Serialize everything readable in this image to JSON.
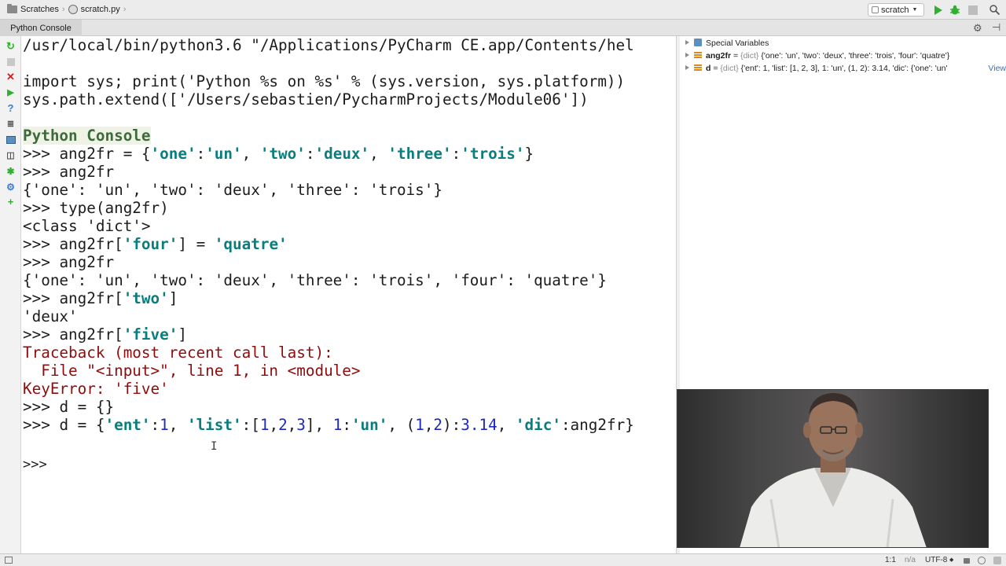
{
  "navbar": {
    "breadcrumb": [
      "Scratches",
      "scratch.py"
    ],
    "run_config": "scratch"
  },
  "tool_window": {
    "title": "Python Console"
  },
  "console": {
    "startup_command": "/usr/local/bin/python3.6 \"/Applications/PyCharm CE.app/Contents/hel",
    "import_line": "import sys; print('Python %s on %s' % (sys.version, sys.platform))",
    "path_line": "sys.path.extend(['/Users/sebastien/PycharmProjects/Module06'])",
    "header": "Python Console",
    "prompt": ">>>",
    "cmd1": "ang2fr = {'one':'un', 'two':'deux', 'three':'trois'}",
    "cmd1_prefix": "ang2fr = {",
    "cmd1_s1": "'one'",
    "cmd1_s2": "'un'",
    "cmd1_s3": "'two'",
    "cmd1_s4": "'deux'",
    "cmd1_s5": "'three'",
    "cmd1_s6": "'trois'",
    "cmd2": "ang2fr",
    "out2": "{'one': 'un', 'two': 'deux', 'three': 'trois'}",
    "cmd3": "type(ang2fr)",
    "out3": "<class 'dict'>",
    "cmd4_a": "ang2fr[",
    "cmd4_key": "'four'",
    "cmd4_b": "] = ",
    "cmd4_val": "'quatre'",
    "cmd5": "ang2fr",
    "out5": "{'one': 'un', 'two': 'deux', 'three': 'trois', 'four': 'quatre'}",
    "cmd6_a": "ang2fr[",
    "cmd6_key": "'two'",
    "cmd6_b": "]",
    "out6": "'deux'",
    "cmd7_a": "ang2fr[",
    "cmd7_key": "'five'",
    "cmd7_b": "]",
    "tb1": "Traceback (most recent call last):",
    "tb2": "  File \"<input>\", line 1, in <module>",
    "tb3": "KeyError: 'five'",
    "cmd8": "d = {}",
    "cmd9_a": "d = {",
    "cmd9_s1": "'ent'",
    "cmd9_c1": ":",
    "cmd9_n1": "1",
    "cmd9_c2": ", ",
    "cmd9_s2": "'list'",
    "cmd9_c3": ":[",
    "cmd9_n2": "1",
    "cmd9_c4": ",",
    "cmd9_n3": "2",
    "cmd9_c5": ",",
    "cmd9_n4": "3",
    "cmd9_c6": "], ",
    "cmd9_n5": "1",
    "cmd9_c7": ":",
    "cmd9_s3": "'un'",
    "cmd9_c8": ", (",
    "cmd9_n6": "1",
    "cmd9_c9": ",",
    "cmd9_n7": "2",
    "cmd9_c10": "):",
    "cmd9_n8": "3.14",
    "cmd9_c11": ", ",
    "cmd9_s4": "'dic'",
    "cmd9_c12": ":ang2fr}"
  },
  "variables": {
    "header": "Special Variables",
    "rows": [
      {
        "name": "ang2fr",
        "type": "{dict}",
        "value": "{'one': 'un', 'two': 'deux', 'three': 'trois', 'four': 'quatre'}"
      },
      {
        "name": "d",
        "type": "{dict}",
        "value": "{'ent': 1, 'list': [1, 2, 3], 1: 'un', (1, 2): 3.14, 'dic': {'one': 'un'",
        "link": "View"
      }
    ]
  },
  "statusbar": {
    "position": "1:1",
    "na": "n/a",
    "encoding": "UTF-8"
  },
  "colors": {
    "string": "#0b7d7d",
    "number": "#1c28c0",
    "error": "#8e0b0b",
    "header": "#3e6a3b",
    "run": "#2fb12f",
    "close": "#d32020"
  }
}
